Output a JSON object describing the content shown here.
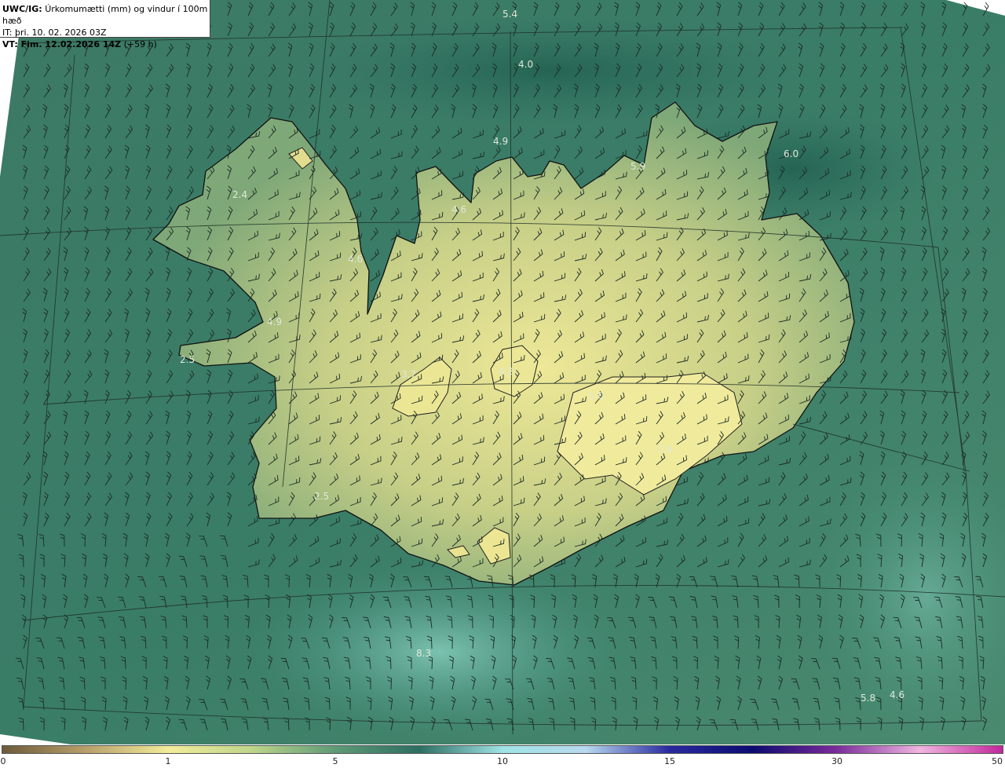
{
  "header": {
    "model": "UWC/IG:",
    "title": "Úrkomumætti (mm) og vindur í 100m hæð",
    "issue_time": "IT: þri. 10. 02. 2026 03Z",
    "valid_prefix": "VT: Fim. 12.02.2026 14Z",
    "valid_suffix": "(+59 h)"
  },
  "value_labels": [
    "5.4",
    "4.0",
    "4.9",
    "5.9",
    "6.0",
    "2.4",
    "4.6",
    "4.6",
    "4.9",
    "2.5",
    "3.7",
    "4.2",
    "1.0",
    "1.6",
    "2.5",
    "8.3",
    "5.8",
    "4.6"
  ],
  "colorbar": {
    "ticks": [
      "0",
      "1",
      "5",
      "10",
      "15",
      "30",
      "50"
    ],
    "stops": [
      "#6b5a3a",
      "#b99f6a",
      "#f2ec9a",
      "#bdd58a",
      "#5f9a76",
      "#2d6e62",
      "#9fe3e6",
      "#b8d9ee",
      "#2a2aa0",
      "#0b0b70",
      "#7a2a9a",
      "#f1b6e0",
      "#c0289a"
    ]
  },
  "colors": {
    "sea_dark": "#2b6c5c",
    "sea_mid": "#3f8169",
    "land_high": "#e6e08e",
    "land_mid": "#9ab87c",
    "barbs": "#1b2a25",
    "coast": "#111111"
  }
}
